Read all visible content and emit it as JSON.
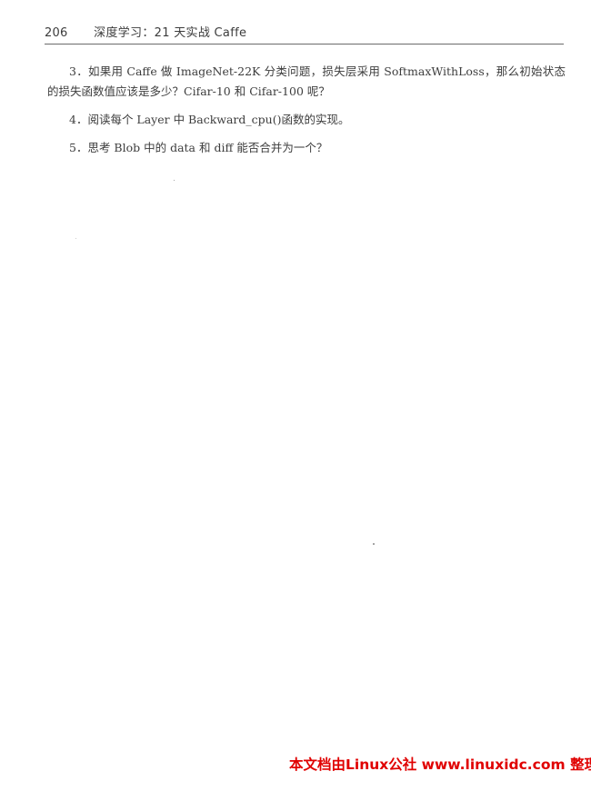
{
  "header": {
    "page_number": "206",
    "book_title": "深度学习：21 天实战 Caffe"
  },
  "questions": [
    {
      "text": "3．如果用 Caffe 做 ImageNet-22K 分类问题，损失层采用 SoftmaxWithLoss，那么初始状态的损失函数值应该是多少？Cifar-10 和 Cifar-100 呢？"
    },
    {
      "text": "4．阅读每个 Layer 中 Backward_cpu()函数的实现。"
    },
    {
      "text": "5．思考 Blob 中的 data 和 diff 能否合并为一个？"
    }
  ],
  "footer": {
    "credit": "本文档由Linux公社 www.linuxidc.com 整理"
  }
}
